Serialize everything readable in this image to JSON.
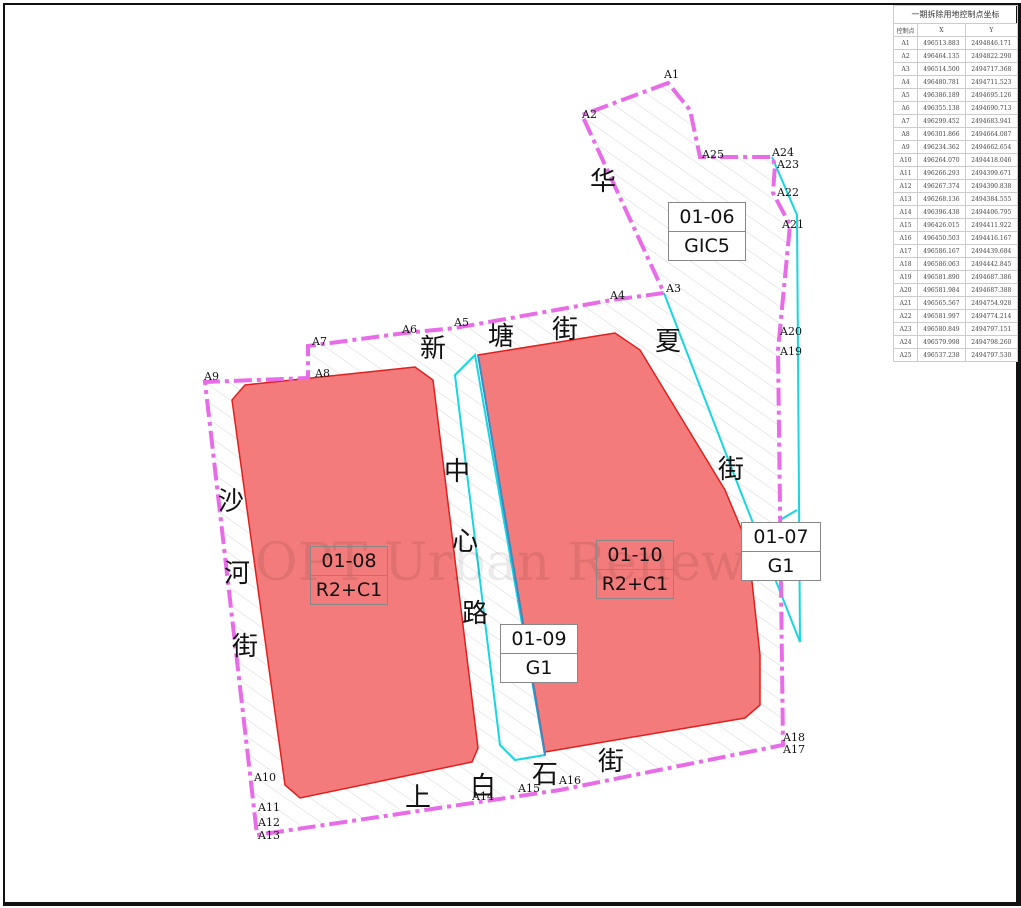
{
  "streets": {
    "xinTang": [
      "新",
      "塘",
      "街"
    ],
    "xiaHua": [
      "夏",
      "华",
      "街"
    ],
    "shaHe": [
      "沙",
      "河",
      "街"
    ],
    "zhongXin": [
      "中",
      "心",
      "路"
    ],
    "shangBaiShi": [
      "上",
      "白",
      "石",
      "街"
    ],
    "huaTop": "华"
  },
  "plots": [
    {
      "code": "01-06",
      "use": "GIC5"
    },
    {
      "code": "01-07",
      "use": "G1"
    },
    {
      "code": "01-08",
      "use": "R2+C1"
    },
    {
      "code": "01-09",
      "use": "G1"
    },
    {
      "code": "01-10",
      "use": "R2+C1"
    }
  ],
  "watermark": "OPT Urban Renewal",
  "colors": {
    "boundary": "#e86be8",
    "plotRed": "#f47b7b",
    "plotCyan": "#18d6e0"
  },
  "table": {
    "title": "一期拆除用地控制点坐标",
    "headers": [
      "控制点",
      "X",
      "Y"
    ],
    "rows": [
      [
        "A1",
        "496513.883",
        "2494846.171"
      ],
      [
        "A2",
        "496464.135",
        "2494822.290"
      ],
      [
        "A3",
        "496514.500",
        "2494717.368"
      ],
      [
        "A4",
        "496480.781",
        "2494711.523"
      ],
      [
        "A5",
        "496386.189",
        "2494695.126"
      ],
      [
        "A6",
        "496355.138",
        "2494690.713"
      ],
      [
        "A7",
        "496299.452",
        "2494683.941"
      ],
      [
        "A8",
        "496301.866",
        "2494664.087"
      ],
      [
        "A9",
        "496234.362",
        "2494662.654"
      ],
      [
        "A10",
        "496264.070",
        "2494418.046"
      ],
      [
        "A11",
        "496266.293",
        "2494399.671"
      ],
      [
        "A12",
        "496267.374",
        "2494390.838"
      ],
      [
        "A13",
        "496268.136",
        "2494384.555"
      ],
      [
        "A14",
        "496396.438",
        "2494406.795"
      ],
      [
        "A15",
        "496426.015",
        "2494411.922"
      ],
      [
        "A16",
        "496450.503",
        "2494416.167"
      ],
      [
        "A17",
        "496586.167",
        "2494439.684"
      ],
      [
        "A18",
        "496586.063",
        "2494442.845"
      ],
      [
        "A19",
        "496581.890",
        "2494687.386"
      ],
      [
        "A20",
        "496581.984",
        "2494687.388"
      ],
      [
        "A21",
        "496565.567",
        "2494754.928"
      ],
      [
        "A22",
        "496581.997",
        "2494774.214"
      ],
      [
        "A23",
        "496580.849",
        "2494797.151"
      ],
      [
        "A24",
        "496579.998",
        "2494798.260"
      ],
      [
        "A25",
        "496537.238",
        "2494797.530"
      ]
    ]
  }
}
